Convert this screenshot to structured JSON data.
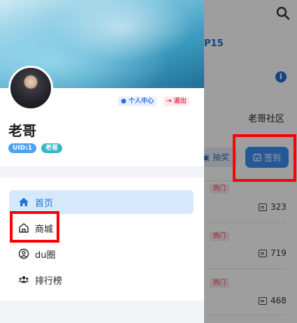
{
  "background_page": {
    "title_fragment": "P15",
    "info_icon": "i",
    "community_label": "老哥社区",
    "lottery_label": "抽奖",
    "checkin_label": "签到",
    "hot_label": "热门",
    "posts": [
      {
        "comments": "323"
      },
      {
        "comments": "719"
      },
      {
        "comments": "468"
      }
    ],
    "colors": {
      "accent": "#3c8ef3",
      "hot": "#e2344a"
    }
  },
  "drawer": {
    "profile": {
      "username": "老哥",
      "uid_tag": "UID:1",
      "name_tag": "老哥",
      "personal_center": "个人中心",
      "logout": "退出"
    },
    "menu": [
      {
        "label": "首页",
        "icon": "home-icon",
        "active": true
      },
      {
        "label": "商城",
        "icon": "shop-icon",
        "active": false
      },
      {
        "label": "du圈",
        "icon": "circle-icon",
        "active": false
      },
      {
        "label": "排行榜",
        "icon": "users-icon",
        "active": false
      }
    ]
  },
  "highlight_color": "#ff0000"
}
